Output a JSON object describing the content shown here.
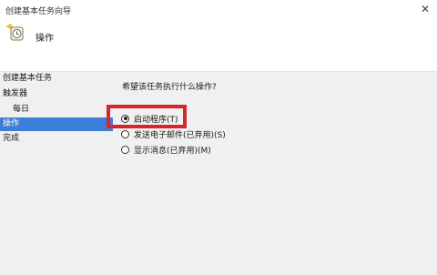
{
  "window": {
    "title": "创建基本任务向导",
    "close_glyph": "✕"
  },
  "header": {
    "heading": "操作"
  },
  "sidebar": {
    "items": [
      {
        "label": "创建基本任务"
      },
      {
        "label": "触发器"
      },
      {
        "label": "每日"
      },
      {
        "label": "操作"
      },
      {
        "label": "完成"
      }
    ],
    "active_index": 3
  },
  "main": {
    "prompt": "希望该任务执行什么操作?",
    "options": [
      {
        "label": "启动程序(T)",
        "checked": true
      },
      {
        "label": "发送电子邮件(已弃用)(S)",
        "checked": false
      },
      {
        "label": "显示消息(已弃用)(M)",
        "checked": false
      }
    ]
  },
  "colors": {
    "sidebar_active": "#3c7fd6",
    "highlight": "#d6252b"
  }
}
